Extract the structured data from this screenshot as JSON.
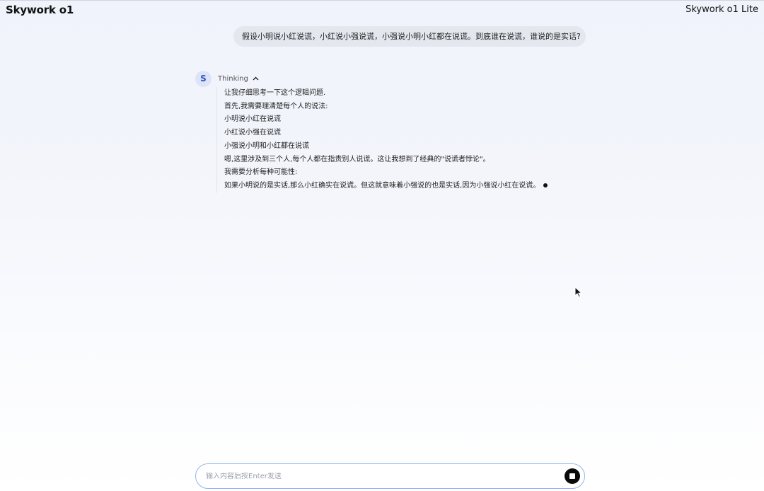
{
  "header": {
    "app_title": "Skywork o1",
    "model_label": "Skywork o1 Lite"
  },
  "conversation": {
    "user_message": "假设小明说小红说谎，小红说小强说谎，小强说小明小红都在说谎。到底谁在说谎，谁说的是实话?",
    "assistant": {
      "avatar_letter": "S",
      "thinking_label": "Thinking",
      "thinking_lines": [
        "让我仔细思考一下这个逻辑问题.",
        "首先,我需要理清楚每个人的说法:",
        "小明说小红在说谎",
        "小红说小强在说谎",
        "小强说小明和小红都在说谎",
        "嗯,这里涉及到三个人,每个人都在指责别人说谎。这让我想到了经典的\"说谎者悖论\"。",
        "我需要分析每种可能性:",
        "如果小明说的是实话,那么小红确实在说谎。但这就意味着小强说的也是实话,因为小强说小红在说谎。"
      ]
    }
  },
  "composer": {
    "placeholder": "输入内容后按Enter发送"
  },
  "icons": {
    "toggle": "chevron-up-icon",
    "stop": "stop-icon",
    "pointer": "mouse-cursor-icon"
  }
}
